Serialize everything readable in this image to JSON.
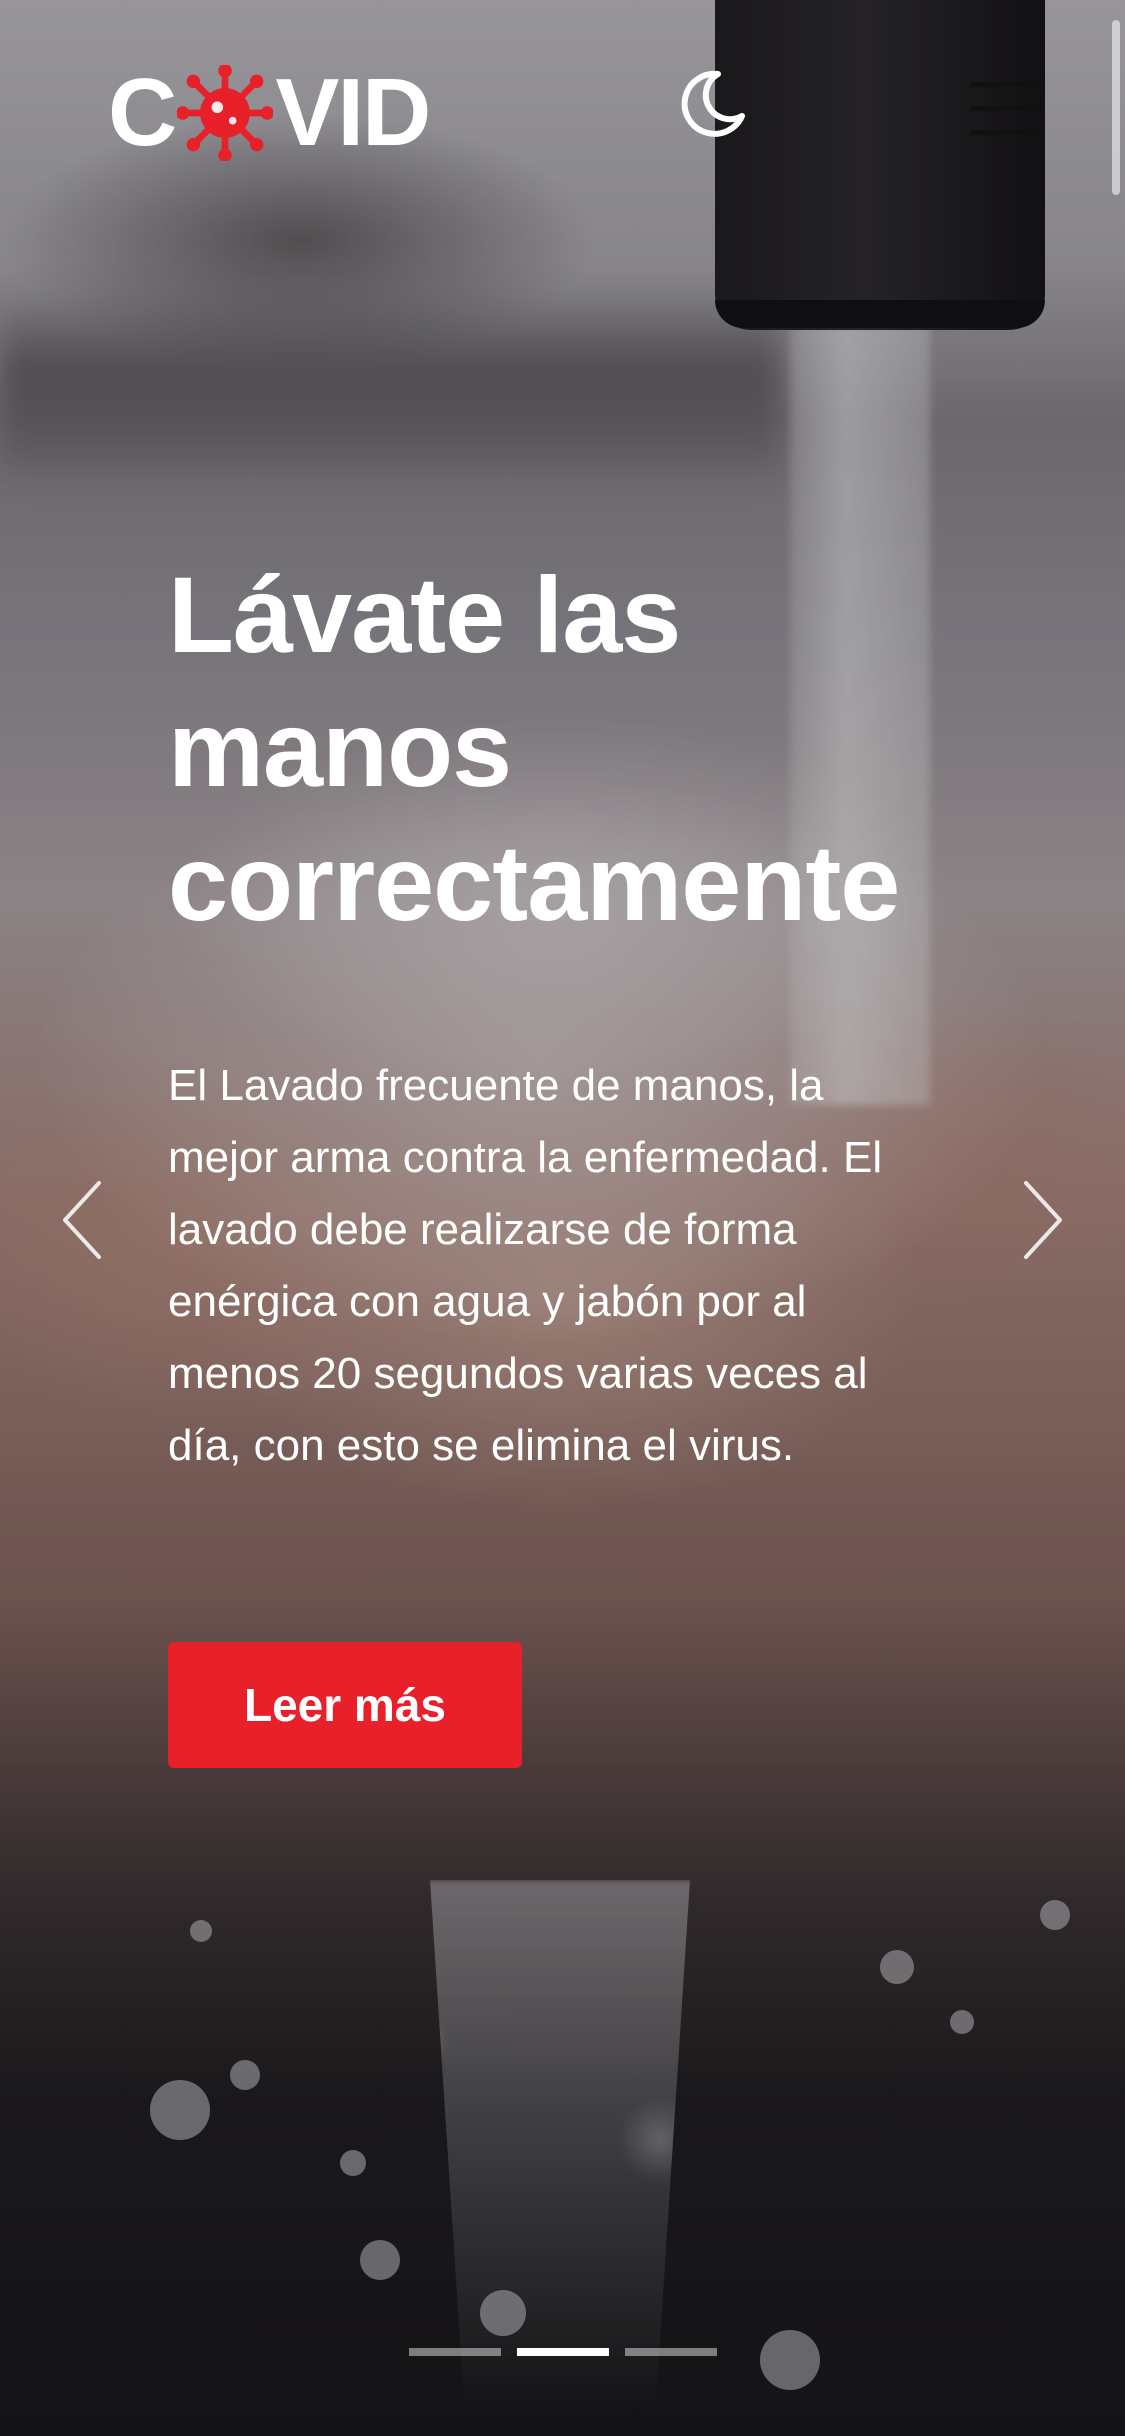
{
  "header": {
    "logo_text_before": "C",
    "logo_text_after": "VID",
    "logo_icon": "virus-icon",
    "theme_toggle_icon": "moon-icon",
    "menu_icon": "hamburger-menu-icon"
  },
  "slide": {
    "title": "Lávate las manos correctamente",
    "body": "El Lavado frecuente de manos, la mejor arma contra la enfermedad. El lavado debe realizarse de forma enérgica con agua y jabón por al menos 20 segundos varias veces al día, con esto se elimina el virus.",
    "cta_label": "Leer más"
  },
  "carousel": {
    "prev_icon": "chevron-left-icon",
    "next_icon": "chevron-right-icon",
    "slide_count": 3,
    "active_index": 1
  },
  "colors": {
    "accent": "#e8202a",
    "text": "#ffffff"
  }
}
